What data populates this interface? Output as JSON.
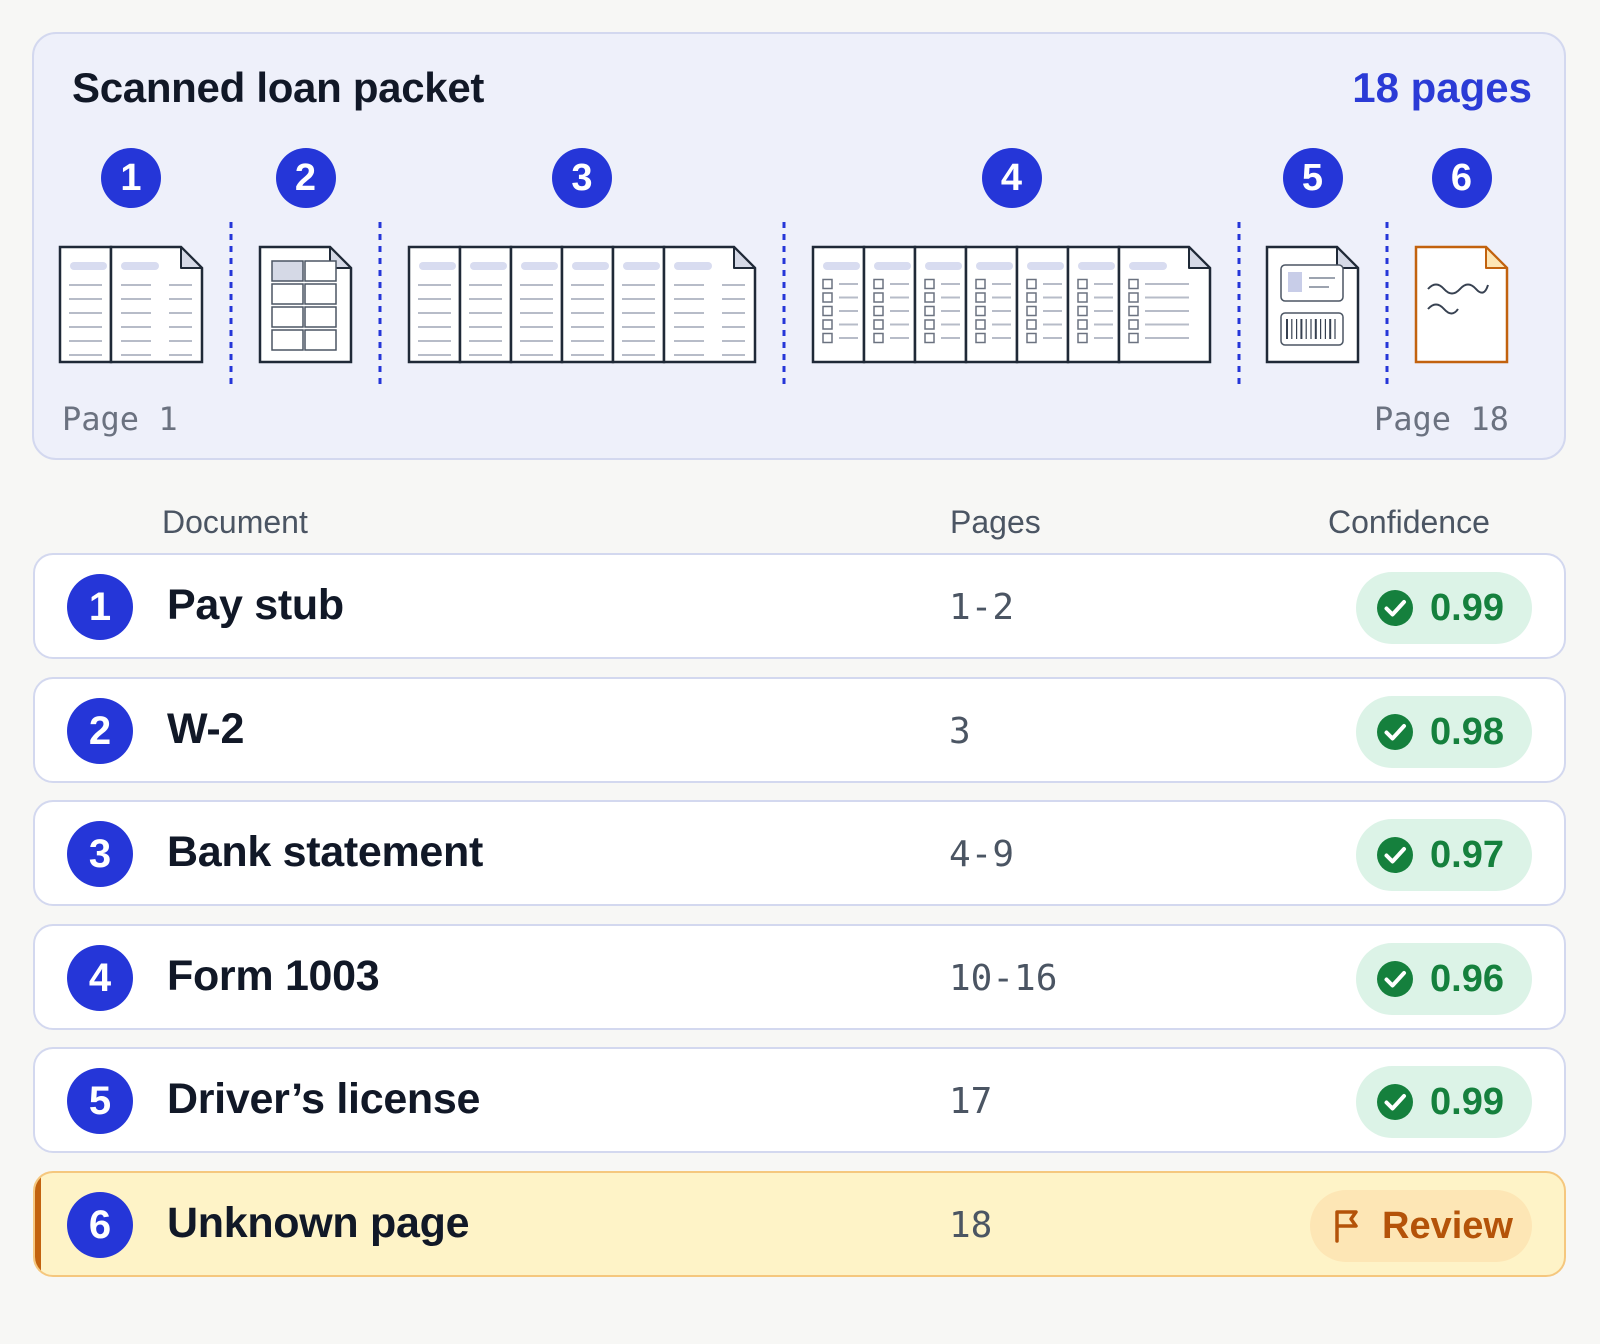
{
  "packet": {
    "title": "Scanned loan packet",
    "page_count_label": "18 pages",
    "start_label": "Page 1",
    "end_label": "Page 18",
    "segments": [
      {
        "number": "1",
        "page_count": 2,
        "kind": "lined-doc"
      },
      {
        "number": "2",
        "page_count": 1,
        "kind": "form-grid"
      },
      {
        "number": "3",
        "page_count": 6,
        "kind": "lined-doc"
      },
      {
        "number": "4",
        "page_count": 7,
        "kind": "checklist"
      },
      {
        "number": "5",
        "page_count": 1,
        "kind": "id-card"
      },
      {
        "number": "6",
        "page_count": 1,
        "kind": "unknown-scribble"
      }
    ],
    "colors": {
      "badge": "#2536d8",
      "divider": "#2536d8",
      "unknown_page": "#c2620e"
    }
  },
  "table": {
    "headers": {
      "document": "Document",
      "pages": "Pages",
      "confidence": "Confidence"
    },
    "rows": [
      {
        "number": "1",
        "name": "Pay stub",
        "pages": "1-2",
        "status": "ok",
        "confidence": "0.99",
        "icon": "check-circle-icon"
      },
      {
        "number": "2",
        "name": "W-2",
        "pages": "3",
        "status": "ok",
        "confidence": "0.98",
        "icon": "check-circle-icon"
      },
      {
        "number": "3",
        "name": "Bank statement",
        "pages": "4-9",
        "status": "ok",
        "confidence": "0.97",
        "icon": "check-circle-icon"
      },
      {
        "number": "4",
        "name": "Form 1003",
        "pages": "10-16",
        "status": "ok",
        "confidence": "0.96",
        "icon": "check-circle-icon"
      },
      {
        "number": "5",
        "name": "Driver’s license",
        "pages": "17",
        "status": "ok",
        "confidence": "0.99",
        "icon": "check-circle-icon"
      },
      {
        "number": "6",
        "name": "Unknown page",
        "pages": "18",
        "status": "review",
        "confidence": "Review",
        "icon": "flag-icon"
      }
    ],
    "colors": {
      "ok_bg": "#dcf3e7",
      "ok_text": "#15803d",
      "review_bg": "#fde6b5",
      "review_text": "#b45309",
      "review_row_bg": "#fef3c7"
    }
  }
}
